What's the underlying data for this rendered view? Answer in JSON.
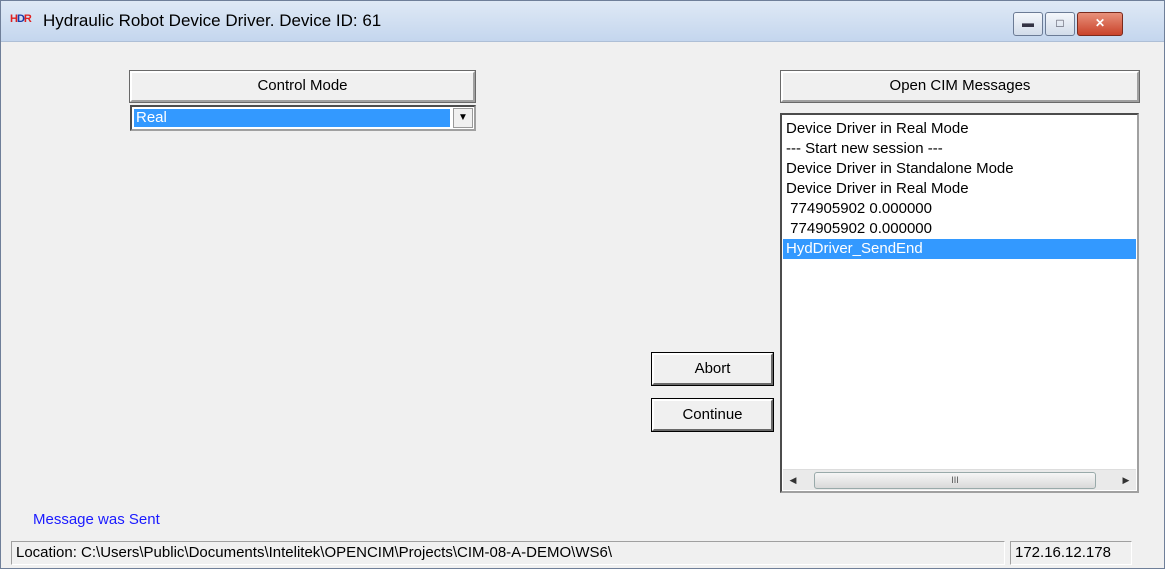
{
  "window": {
    "title": "Hydraulic Robot Device Driver. Device ID: 61",
    "icon_text": "HDR"
  },
  "control_mode": {
    "header": "Control Mode",
    "selected": "Real"
  },
  "messages": {
    "header": "Open CIM Messages",
    "items": [
      {
        "text": "Device Driver in Real Mode",
        "selected": false
      },
      {
        "text": "--- Start new session ---",
        "selected": false
      },
      {
        "text": "Device Driver in Standalone Mode",
        "selected": false
      },
      {
        "text": "Device Driver in Real Mode",
        "selected": false
      },
      {
        "text": " 774905902 0.000000",
        "selected": false
      },
      {
        "text": " 774905902 0.000000",
        "selected": false
      },
      {
        "text": "HydDriver_SendEnd",
        "selected": true
      }
    ],
    "scroll_thumb_glyph": "III"
  },
  "buttons": {
    "abort": "Abort",
    "continue": "Continue"
  },
  "status": {
    "message": "Message was Sent",
    "location": "Location: C:\\Users\\Public\\Documents\\Intelitek\\OPENCIM\\Projects\\CIM-08-A-DEMO\\WS6\\",
    "ip": "172.16.12.178"
  },
  "icons": {
    "minimize": "minimize-icon",
    "maximize": "maximize-icon",
    "close": "close-icon",
    "dropdown": "chevron-down-icon",
    "scroll_left": "chevron-left-icon",
    "scroll_right": "chevron-right-icon"
  }
}
